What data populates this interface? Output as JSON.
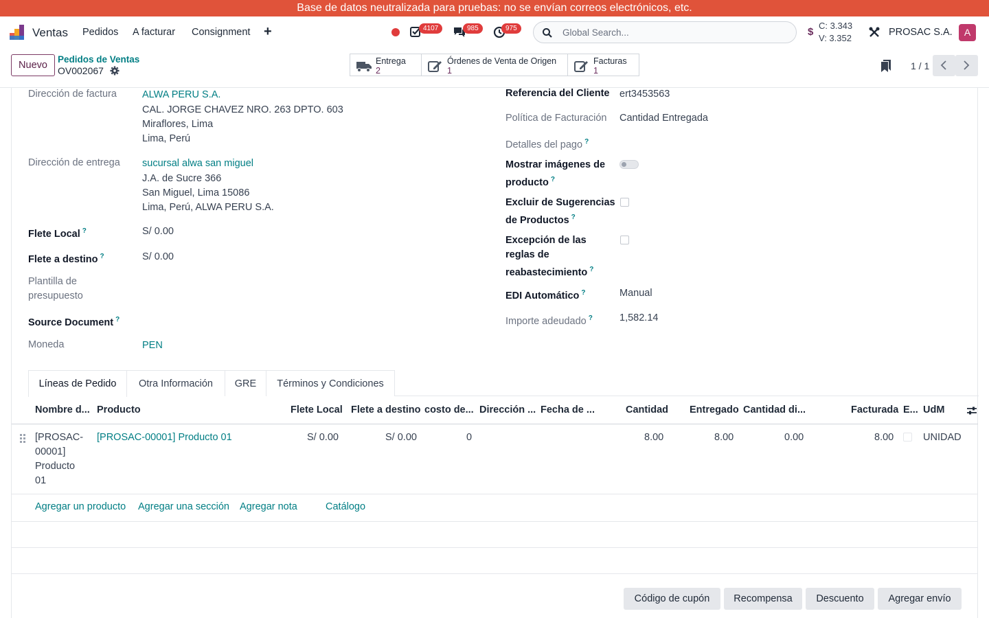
{
  "banner": "Base de datos neutralizada para pruebas: no se envían correos electrónicos, etc.",
  "navbar": {
    "app_name": "Ventas",
    "menu": [
      "Pedidos",
      "A facturar",
      "Consignment"
    ],
    "badges": {
      "activities": "4107",
      "messages": "985",
      "timers": "975"
    },
    "search_placeholder": "Global Search...",
    "currency_symbol": "$",
    "rate_c": "C: 3.343",
    "rate_v": "V: 3.352",
    "company": "PROSAC S.A.",
    "avatar_letter": "A"
  },
  "control": {
    "new_button": "Nuevo",
    "breadcrumb_parent": "Pedidos de Ventas",
    "record_name": "OV002067",
    "smart_buttons": [
      {
        "label": "Entrega",
        "value": "2",
        "icon": "truck-icon"
      },
      {
        "label": "Órdenes de Venta de Origen",
        "value": "1",
        "icon": "edit-icon"
      },
      {
        "label": "Facturas",
        "value": "1",
        "icon": "edit-icon"
      }
    ],
    "pager": "1 / 1"
  },
  "form_left": {
    "invoice_address_label": "Dirección de factura",
    "invoice_partner": "ALWA PERU S.A.",
    "invoice_lines": [
      "CAL. JORGE CHAVEZ NRO. 263 DPTO. 603",
      "Miraflores, Lima",
      "Lima, Perú"
    ],
    "delivery_address_label": "Dirección de entrega",
    "delivery_partner": "sucursal alwa san miguel",
    "delivery_lines": [
      "J.A. de Sucre 366",
      "San Miguel, Lima 15086",
      "Lima, Perú, ALWA PERU S.A."
    ],
    "local_freight_label": "Flete Local",
    "local_freight_value": "S/ 0.00",
    "dest_freight_label": "Flete a destino",
    "dest_freight_value": "S/ 0.00",
    "template_label_1": "Plantilla de",
    "template_label_2": "presupuesto",
    "source_doc_label": "Source Document",
    "currency_label": "Moneda",
    "currency_value": "PEN"
  },
  "form_right": {
    "client_ref_label": "Referencia del Cliente",
    "client_ref_value": "ert3453563",
    "billing_policy_label": "Política de Facturación",
    "billing_policy_value": "Cantidad Entregada",
    "payment_details_label": "Detalles del pago",
    "show_images_label_1": "Mostrar imágenes de",
    "show_images_label_2": "producto",
    "exclude_suggestions_label_1": "Excluir de Sugerencias",
    "exclude_suggestions_label_2": "de Productos",
    "replenish_exception_label_1": "Excepción de las",
    "replenish_exception_label_2": "reglas de",
    "replenish_exception_label_3": "reabastecimiento",
    "edi_label": "EDI Automático",
    "edi_value": "Manual",
    "amount_due_label": "Importe adeudado",
    "amount_due_value": "1,582.14"
  },
  "tabs": [
    "Líneas de Pedido",
    "Otra Información",
    "GRE",
    "Términos y Condiciones"
  ],
  "table": {
    "headers": [
      "Nombre d...",
      "Producto",
      "Flete Local",
      "Flete a destino",
      "costo de...",
      "Dirección ...",
      "Fecha de ...",
      "Cantidad",
      "Entregado",
      "Cantidad di...",
      "Facturada",
      "E...",
      "UdM"
    ],
    "rows": [
      {
        "name_lines": [
          "[PROSAC-",
          "00001]",
          "Producto",
          "01"
        ],
        "product": "[PROSAC-00001] Producto 01",
        "local_freight": "S/ 0.00",
        "dest_freight": "S/ 0.00",
        "cost": "0",
        "quantity": "8.00",
        "delivered": "8.00",
        "qty_available": "0.00",
        "invoiced": "8.00",
        "uom": "UNIDAD"
      }
    ],
    "add_links": [
      "Agregar un producto",
      "Agregar una sección",
      "Agregar nota",
      "Catálogo"
    ]
  },
  "bottom_buttons": [
    "Código de cupón",
    "Recompensa",
    "Descuento",
    "Agregar envío"
  ],
  "colors": {
    "brand": "#6b2e5e",
    "link": "#017e84",
    "banner": "#e0533a",
    "badge": "#e03c3c"
  }
}
